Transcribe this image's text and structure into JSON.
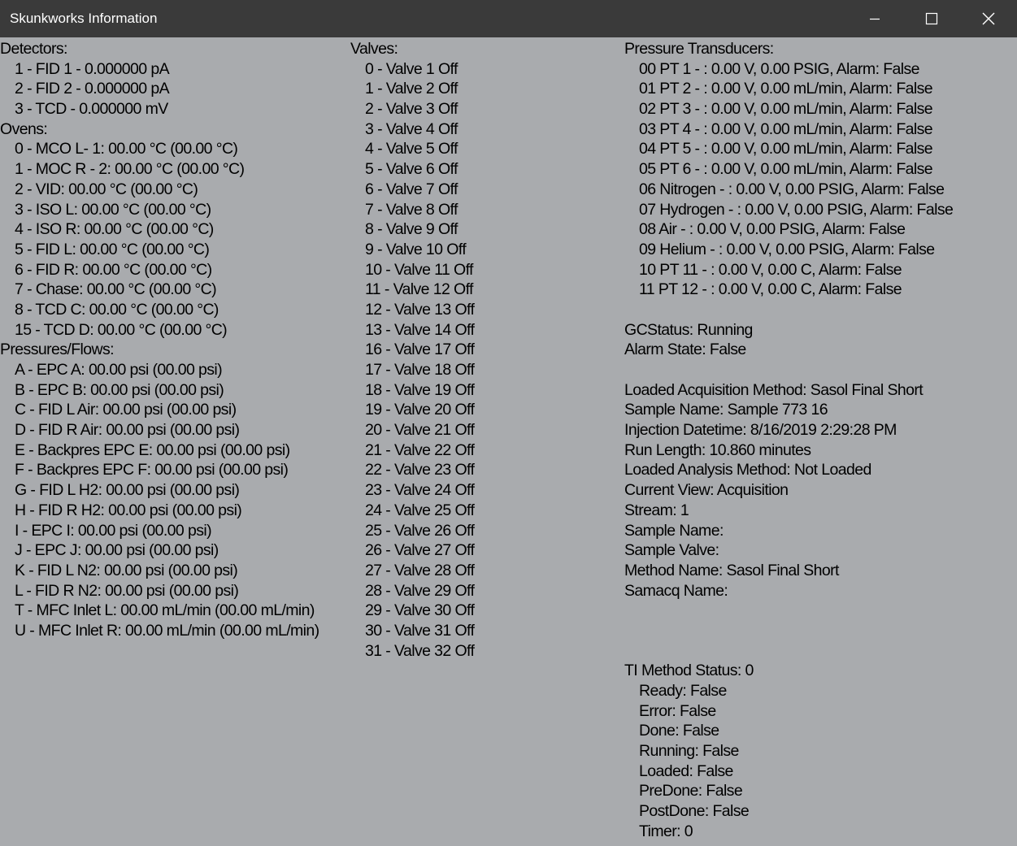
{
  "window": {
    "title": "Skunkworks Information",
    "controls": {
      "minimize_icon": "minimize-icon",
      "maximize_icon": "maximize-icon",
      "close_icon": "close-icon"
    },
    "colors": {
      "titlebar": "#3a3a3a",
      "background": "#a9abae",
      "text": "#000000"
    }
  },
  "detectors": {
    "header": "Detectors:",
    "items": [
      "1 - FID 1 - 0.000000 pA",
      "2 - FID 2 - 0.000000 pA",
      "3 - TCD - 0.000000 mV"
    ]
  },
  "ovens": {
    "header": "Ovens:",
    "items": [
      "0 - MCO L- 1: 00.00 °C (00.00 °C)",
      "1 - MOC R - 2: 00.00 °C (00.00 °C)",
      "2 - VID: 00.00 °C (00.00 °C)",
      "3 - ISO L: 00.00 °C (00.00 °C)",
      "4 - ISO R: 00.00 °C (00.00 °C)",
      "5 - FID L: 00.00 °C (00.00 °C)",
      "6 - FID R: 00.00 °C (00.00 °C)",
      "7 - Chase: 00.00 °C (00.00 °C)",
      "8 - TCD C: 00.00 °C (00.00 °C)",
      "15 - TCD D: 00.00 °C (00.00 °C)"
    ]
  },
  "pressures": {
    "header": "Pressures/Flows:",
    "items": [
      "A - EPC A: 00.00 psi (00.00 psi)",
      "B - EPC B: 00.00 psi (00.00 psi)",
      "C - FID L Air: 00.00 psi (00.00 psi)",
      "D - FID R Air: 00.00 psi (00.00 psi)",
      "E - Backpres EPC E: 00.00 psi (00.00 psi)",
      "F - Backpres EPC F: 00.00 psi (00.00 psi)",
      "G - FID L H2: 00.00 psi (00.00 psi)",
      "H - FID R H2: 00.00 psi (00.00 psi)",
      "I - EPC I: 00.00 psi (00.00 psi)",
      "J - EPC J: 00.00 psi (00.00 psi)",
      "K - FID L N2: 00.00 psi (00.00 psi)",
      "L - FID R N2: 00.00 psi (00.00 psi)",
      "T - MFC Inlet L: 00.00 mL/min (00.00 mL/min)",
      "U - MFC Inlet R: 00.00 mL/min (00.00 mL/min)"
    ]
  },
  "valves": {
    "header": "Valves:",
    "items": [
      "0 - Valve 1 Off",
      "1 - Valve 2 Off",
      "2 - Valve 3 Off",
      "3 - Valve 4 Off",
      "4 - Valve 5 Off",
      "5 - Valve 6 Off",
      "6 - Valve 7 Off",
      "7 - Valve 8 Off",
      "8 - Valve 9 Off",
      "9 - Valve 10 Off",
      "10 - Valve 11 Off",
      "11 - Valve 12 Off",
      "12 - Valve 13 Off",
      "13 - Valve 14 Off",
      "16 - Valve 17 Off",
      "17 - Valve 18 Off",
      "18 - Valve 19 Off",
      "19 - Valve 20 Off",
      "20 - Valve 21 Off",
      "21 - Valve 22 Off",
      "22 - Valve 23 Off",
      "23 - Valve 24 Off",
      "24 - Valve 25 Off",
      "25 - Valve 26 Off",
      "26 - Valve 27 Off",
      "27 - Valve 28 Off",
      "28 - Valve 29 Off",
      "29 - Valve 30 Off",
      "30 - Valve 31 Off",
      "31 - Valve 32 Off"
    ]
  },
  "transducers": {
    "header": "Pressure Transducers:",
    "items": [
      "00 PT 1 - : 0.00 V, 0.00 PSIG, Alarm: False",
      "01 PT 2 - : 0.00 V, 0.00 mL/min, Alarm: False",
      "02 PT 3 - : 0.00 V, 0.00 mL/min, Alarm: False",
      "03 PT 4 - : 0.00 V, 0.00 mL/min, Alarm: False",
      "04 PT 5 - : 0.00 V, 0.00 mL/min, Alarm: False",
      "05 PT 6 - : 0.00 V, 0.00 mL/min, Alarm: False",
      "06 Nitrogen - : 0.00 V, 0.00 PSIG, Alarm: False",
      "07 Hydrogen - : 0.00 V, 0.00 PSIG, Alarm: False",
      "08 Air - : 0.00 V, 0.00 PSIG, Alarm: False",
      "09 Helium - : 0.00 V, 0.00 PSIG, Alarm: False",
      "10 PT 11 - : 0.00 V, 0.00 C, Alarm: False",
      "11 PT 12 - : 0.00 V, 0.00 C, Alarm: False"
    ]
  },
  "status": {
    "gc_status": "GCStatus: Running",
    "alarm_state": "Alarm State: False"
  },
  "run": {
    "acquisition_method": "Loaded Acquisition Method: Sasol Final Short",
    "sample_name": "Sample Name: Sample 773 16",
    "injection_datetime": "Injection Datetime: 8/16/2019 2:29:28 PM",
    "run_length": "Run Length: 10.860 minutes",
    "analysis_method": "Loaded Analysis Method: Not Loaded",
    "current_view": "Current View: Acquisition",
    "stream": "Stream: 1",
    "sample_name_2": "Sample Name:",
    "sample_valve": "Sample Valve:",
    "method_name": "Method Name: Sasol Final Short",
    "samacq_name": "Samacq Name:"
  },
  "ti_method": {
    "header": "TI Method Status: 0",
    "items": [
      "Ready: False",
      "Error: False",
      "Done: False",
      "Running: False",
      "Loaded: False",
      "PreDone: False",
      "PostDone: False",
      "Timer: 0"
    ]
  }
}
